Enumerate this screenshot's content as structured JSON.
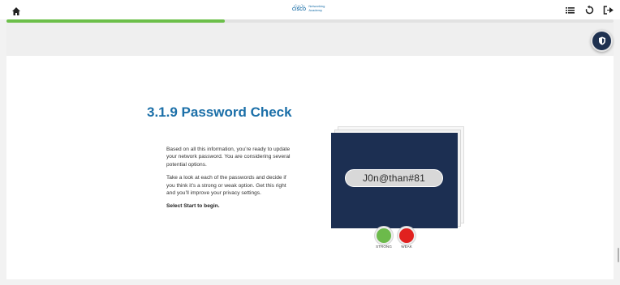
{
  "topbar": {
    "home_icon": "home-icon",
    "logo_brand": "CISCO",
    "logo_line1": "Networking",
    "logo_line2": "Academy",
    "menu_icon": "list-menu-icon",
    "restart_icon": "restart-icon",
    "exit_icon": "exit-icon"
  },
  "progress": {
    "value_fraction": 0.36,
    "color": "#6cbf4a"
  },
  "shield_icon": "shield-icon",
  "main": {
    "title": "3.1.9 Password Check",
    "paragraphs": [
      "Based on all this information, you’re ready to update your network password. You are considering several potential options.",
      "Take a look at each of the passwords and decide if you think it’s a strong or weak option. Get this right and you’ll improve your privacy settings."
    ],
    "cta": "Select Start to begin."
  },
  "activity": {
    "password": "J0n@than#81",
    "card_color": "#1c2f52",
    "strong_label": "STRONG",
    "weak_label": "WEAK",
    "strong_color": "#6cba4b",
    "weak_color": "#e1211f"
  },
  "colors": {
    "accent": "#1b6fa8"
  }
}
